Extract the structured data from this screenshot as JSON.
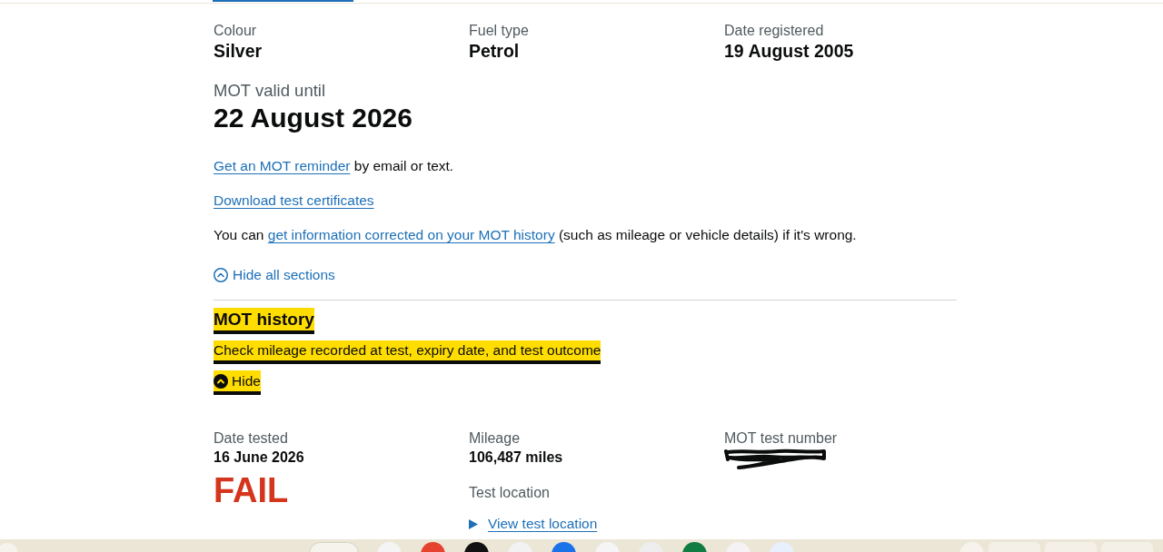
{
  "vehicle_details": [
    {
      "label": "Colour",
      "value": "Silver"
    },
    {
      "label": "Fuel type",
      "value": "Petrol"
    },
    {
      "label": "Date registered",
      "value": "19 August 2005"
    }
  ],
  "mot_validity": {
    "label": "MOT valid until",
    "value": "22 August 2026"
  },
  "paragraphs": [
    {
      "link": "Get an MOT reminder",
      "after": " by email or text."
    },
    {
      "link": "Download test certificates"
    },
    {
      "before": "You can ",
      "link": "get information corrected on your MOT history",
      "after": " (such as mileage or vehicle details) if it's wrong."
    }
  ],
  "accordion": {
    "toggle_all": "Hide all sections",
    "sections": [
      {
        "heading": "MOT history",
        "summary": "Check mileage recorded at test, expiry date, and test outcome",
        "toggle": "Hide",
        "expanded": true,
        "focused": true,
        "tests": [
          {
            "date_label": "Date tested",
            "date": "16 June 2026",
            "result": "FAIL",
            "failed": true,
            "mileage_label": "Mileage",
            "mileage": "106,487 miles",
            "location_label": "Test location",
            "location_link": "View test location",
            "location_expanded": false,
            "number_label": "MOT test number",
            "number_redacted": true
          }
        ]
      }
    ]
  }
}
